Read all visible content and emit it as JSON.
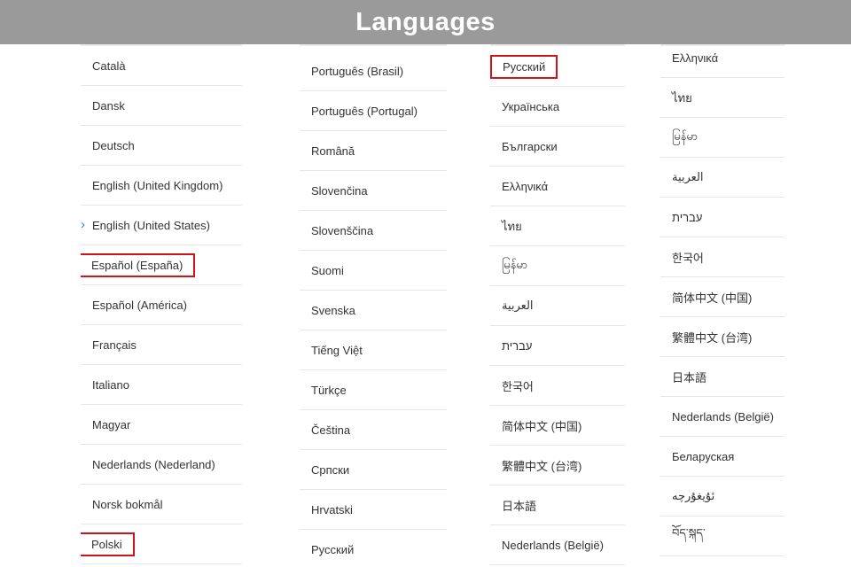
{
  "header": {
    "title": "Languages"
  },
  "columns": [
    {
      "items": [
        "Català",
        "Dansk",
        "Deutsch",
        "English (United Kingdom)",
        "English (United States)",
        "Español (España)",
        "Español (América)",
        "Français",
        "Italiano",
        "Magyar",
        "Nederlands (Nederland)",
        "Norsk bokmål",
        "Polski"
      ],
      "selected_index": 4,
      "highlighted_indices": [
        5,
        12
      ]
    },
    {
      "items": [
        "Português (Brasil)",
        "Português (Portugal)",
        "Română",
        "Slovenčina",
        "Slovenščina",
        "Suomi",
        "Svenska",
        "Tiếng Việt",
        "Türkçe",
        "Čeština",
        "Српски",
        "Hrvatski",
        "Русский"
      ],
      "highlighted_indices": []
    },
    {
      "items": [
        "Русский",
        "Українська",
        "Български",
        "Ελληνικά",
        "ไทย",
        "မြန်မာ",
        "العربية",
        "עברית",
        "한국어",
        "简体中文 (中国)",
        "繁體中文 (台湾)",
        "日本語",
        "Nederlands (België)"
      ],
      "highlighted_indices": [
        0
      ]
    },
    {
      "items": [
        "Ελληνικά",
        "ไทย",
        "မြန်မာ",
        "العربية",
        "עברית",
        "한국어",
        "简体中文 (中国)",
        "繁體中文 (台湾)",
        "日本語",
        "Nederlands (België)",
        "Беларуская",
        "ئۇيغۇرچە",
        "བོད་སྐད་"
      ],
      "highlighted_indices": []
    }
  ],
  "colors": {
    "header_bg": "#9a9a9a",
    "highlight_box": "#d0121b",
    "selected_chevron": "#1a8ad6"
  },
  "icons": {
    "selected_marker": "chevron-right-icon"
  }
}
